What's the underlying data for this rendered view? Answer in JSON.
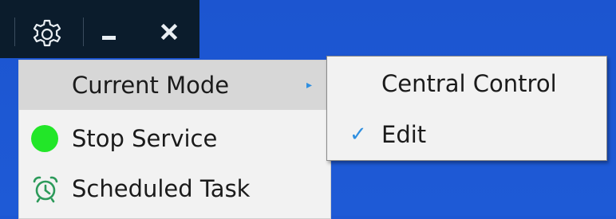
{
  "colors": {
    "desktop": "#1d57d3",
    "titlebar": "#0b1c2c",
    "menu_bg": "#f2f2f2",
    "menu_highlight": "#d7d7d7",
    "accent": "#2f8fe0",
    "status_green": "#22e628"
  },
  "titlebar": {
    "icons": [
      "gear-icon",
      "minimize-icon",
      "close-icon"
    ]
  },
  "menu": {
    "items": [
      {
        "label": "Current Mode",
        "icon": null,
        "has_submenu": true,
        "highlighted": true
      },
      {
        "label": "Stop Service",
        "icon": "green-status-dot-icon"
      },
      {
        "label": "Scheduled Task",
        "icon": "alarm-clock-icon"
      }
    ]
  },
  "submenu": {
    "items": [
      {
        "label": "Central Control",
        "checked": false
      },
      {
        "label": "Edit",
        "checked": true
      }
    ],
    "check_glyph": "✓"
  },
  "arrow_glyph": "▸"
}
